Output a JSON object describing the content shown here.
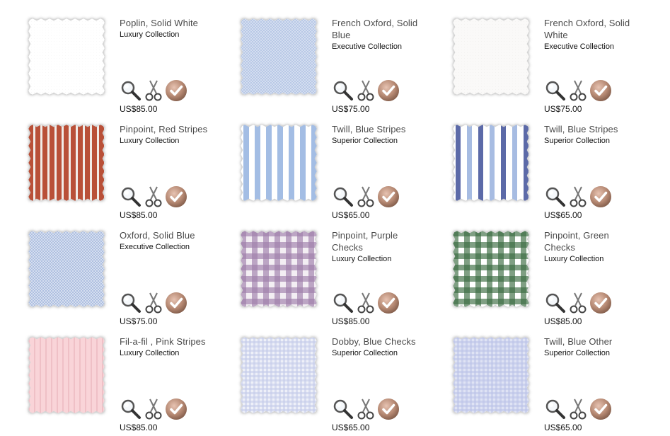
{
  "icons": {
    "zoom": "magnifier-icon",
    "cut": "scissors-icon",
    "select": "checkmark-icon"
  },
  "fabrics": [
    {
      "name": "Poplin, Solid White",
      "collection": "Luxury Collection",
      "price": "US$85.00",
      "pattern": "solid",
      "colors": [
        "#ffffff",
        "#f4f4f4"
      ]
    },
    {
      "name": "French Oxford, Solid Blue",
      "collection": "Executive Collection",
      "price": "US$75.00",
      "pattern": "oxford",
      "colors": [
        "#d4def0",
        "#b8c8e6"
      ]
    },
    {
      "name": "French Oxford, Solid White",
      "collection": "Executive Collection",
      "price": "US$75.00",
      "pattern": "solid",
      "colors": [
        "#faf9f8",
        "#efedeb"
      ]
    },
    {
      "name": "Pinpoint, Red Stripes",
      "collection": "Luxury Collection",
      "price": "US$85.00",
      "pattern": "stripes",
      "colors": [
        "#f1ece8",
        "#b95038"
      ]
    },
    {
      "name": "Twill, Blue Stripes",
      "collection": "Superior Collection",
      "price": "US$65.00",
      "pattern": "widestripes",
      "colors": [
        "#ffffff",
        "#a3bde4"
      ]
    },
    {
      "name": "Twill, Blue Stripes",
      "collection": "Superior Collection",
      "price": "US$65.00",
      "pattern": "mixstripes",
      "colors": [
        "#ffffff",
        "#5c6aa8",
        "#a7bce2"
      ]
    },
    {
      "name": "Oxford, Solid Blue",
      "collection": "Executive Collection",
      "price": "US$75.00",
      "pattern": "oxford",
      "colors": [
        "#d6dff0",
        "#aebfe0"
      ]
    },
    {
      "name": "Pinpoint, Purple Checks",
      "collection": "Luxury Collection",
      "price": "US$85.00",
      "pattern": "checks",
      "colors": [
        "#f3eef3",
        "#9f7eab"
      ]
    },
    {
      "name": "Pinpoint, Green Checks",
      "collection": "Luxury Collection",
      "price": "US$85.00",
      "pattern": "checks",
      "colors": [
        "#ffffff",
        "#3a6b40"
      ]
    },
    {
      "name": "Fil-a-fil , Pink Stripes",
      "collection": "Luxury Collection",
      "price": "US$85.00",
      "pattern": "faintstripes",
      "colors": [
        "#f9d4d8",
        "#efc0c6"
      ]
    },
    {
      "name": "Dobby, Blue Checks",
      "collection": "Superior Collection",
      "price": "US$65.00",
      "pattern": "smallchecks",
      "colors": [
        "#eef0f8",
        "#c3c9e8"
      ]
    },
    {
      "name": "Twill, Blue Other",
      "collection": "Superior Collection",
      "price": "US$65.00",
      "pattern": "smallchecks",
      "colors": [
        "#dfe3f4",
        "#b9c2e6"
      ]
    }
  ]
}
